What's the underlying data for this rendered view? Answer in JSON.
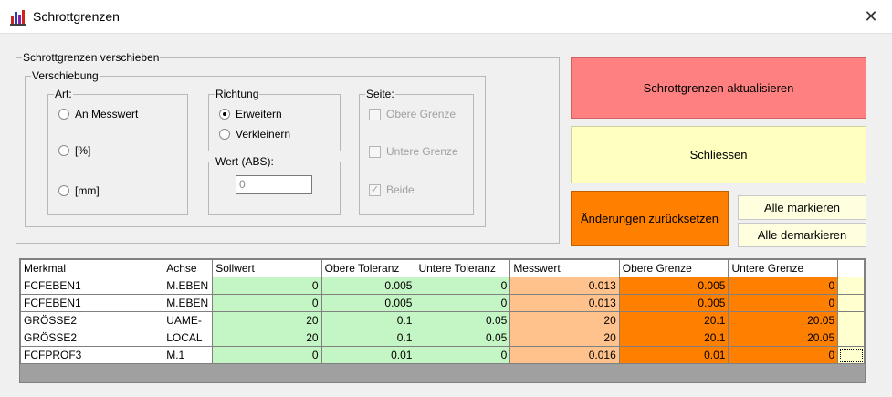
{
  "window": {
    "title": "Schrottgrenzen",
    "close_label": "✕"
  },
  "group_main": {
    "legend": "Schrottgrenzen verschieben",
    "verschiebung": {
      "legend": "Verschiebung",
      "art": {
        "legend": "Art:",
        "options": [
          "An Messwert",
          "[%]",
          "[mm]"
        ]
      },
      "richtung": {
        "legend": "Richtung",
        "options": [
          "Erweitern",
          "Verkleinern"
        ],
        "selected": "Erweitern"
      },
      "wert": {
        "legend": "Wert (ABS):",
        "value": "0"
      },
      "seite": {
        "legend": "Seite:",
        "options": [
          "Obere Grenze",
          "Untere Grenze",
          "Beide"
        ],
        "checked": "Beide"
      }
    }
  },
  "buttons": {
    "aktualisieren": "Schrottgrenzen aktualisieren",
    "schliessen": "Schliessen",
    "zuruecksetzen": "Änderungen zurücksetzen",
    "alle_markieren": "Alle markieren",
    "alle_demarkieren": "Alle demarkieren"
  },
  "colors": {
    "aktualisieren": "#ff8080",
    "schliessen": "#ffffc0",
    "zuruecksetzen": "#ff8000",
    "soll_tol": "#c4f5c4",
    "messwert": "#ffc28c",
    "grenzen": "#ff8000"
  },
  "table": {
    "headers": [
      "Merkmal",
      "Achse",
      "Sollwert",
      "Obere Toleranz",
      "Untere Toleranz",
      "Messwert",
      "Obere Grenze",
      "Untere Grenze",
      ""
    ],
    "rows": [
      [
        "FCFEBEN1",
        "M.EBEN",
        "0",
        "0.005",
        "0",
        "0.013",
        "0.005",
        "0"
      ],
      [
        "FCFEBEN1",
        "M.EBEN",
        "0",
        "0.005",
        "0",
        "0.013",
        "0.005",
        "0"
      ],
      [
        "GRÖSSE2",
        "UAME-",
        "20",
        "0.1",
        "0.05",
        "20",
        "20.1",
        "20.05"
      ],
      [
        "GRÖSSE2",
        "LOCAL",
        "20",
        "0.1",
        "0.05",
        "20",
        "20.1",
        "20.05"
      ],
      [
        "FCFPROF3",
        "M.1",
        "0",
        "0.01",
        "0",
        "0.016",
        "0.01",
        "0"
      ]
    ]
  }
}
